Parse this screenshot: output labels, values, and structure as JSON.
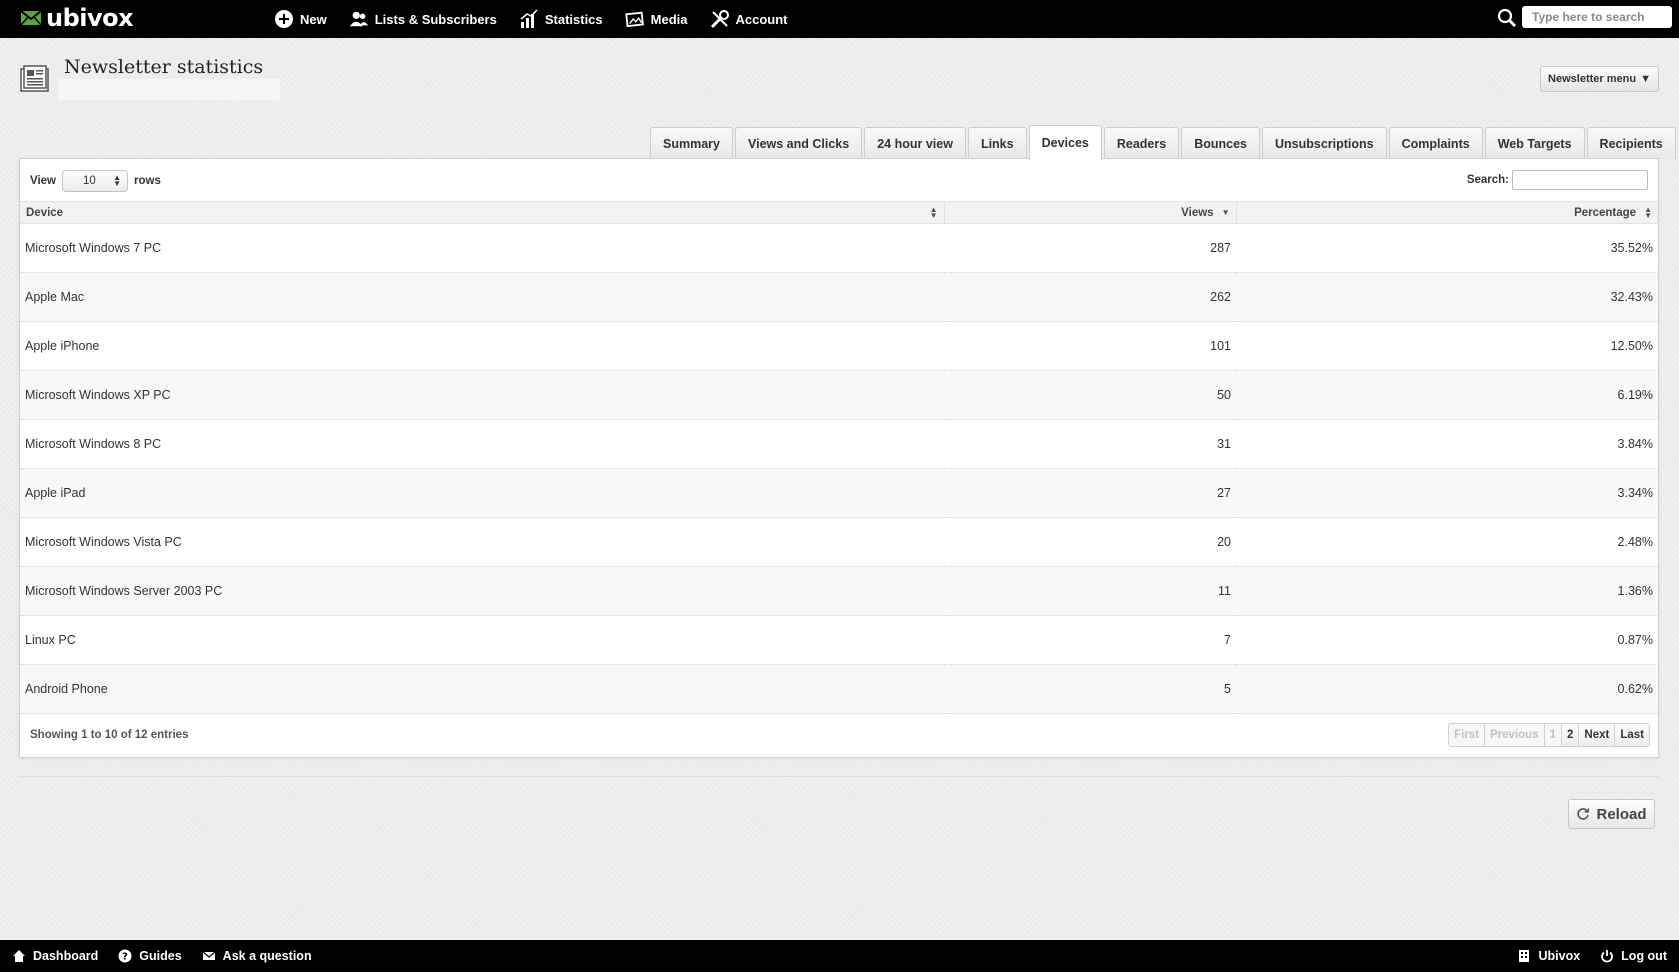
{
  "topbar": {
    "logo_text": "ubivox",
    "nav": [
      {
        "label": "New"
      },
      {
        "label": "Lists & Subscribers"
      },
      {
        "label": "Statistics"
      },
      {
        "label": "Media"
      },
      {
        "label": "Account"
      }
    ],
    "search_placeholder": "Type here to search"
  },
  "header": {
    "title": "Newsletter statistics",
    "menu_label": "Newsletter menu"
  },
  "tabs": [
    {
      "label": "Summary"
    },
    {
      "label": "Views and Clicks"
    },
    {
      "label": "24 hour view"
    },
    {
      "label": "Links"
    },
    {
      "label": "Devices",
      "active": true
    },
    {
      "label": "Readers"
    },
    {
      "label": "Bounces"
    },
    {
      "label": "Unsubscriptions"
    },
    {
      "label": "Complaints"
    },
    {
      "label": "Web Targets"
    },
    {
      "label": "Recipients"
    }
  ],
  "table": {
    "view_label": "View",
    "rows_value": "10",
    "rows_label": "rows",
    "search_label": "Search:",
    "columns": [
      "Device",
      "Views",
      "Percentage"
    ],
    "rows": [
      [
        "Microsoft Windows 7 PC",
        "287",
        "35.52%"
      ],
      [
        "Apple Mac",
        "262",
        "32.43%"
      ],
      [
        "Apple iPhone",
        "101",
        "12.50%"
      ],
      [
        "Microsoft Windows XP PC",
        "50",
        "6.19%"
      ],
      [
        "Microsoft Windows 8 PC",
        "31",
        "3.84%"
      ],
      [
        "Apple iPad",
        "27",
        "3.34%"
      ],
      [
        "Microsoft Windows Vista PC",
        "20",
        "2.48%"
      ],
      [
        "Microsoft Windows Server 2003 PC",
        "11",
        "1.36%"
      ],
      [
        "Linux PC",
        "7",
        "0.87%"
      ],
      [
        "Android Phone",
        "5",
        "0.62%"
      ]
    ],
    "info": "Showing 1 to 10 of 12 entries",
    "pager": {
      "first": "First",
      "previous": "Previous",
      "page1": "1",
      "page2": "2",
      "next": "Next",
      "last": "Last"
    }
  },
  "reload_label": "Reload",
  "footer": {
    "dashboard": "Dashboard",
    "guides": "Guides",
    "ask": "Ask a question",
    "ubivox": "Ubivox",
    "logout": "Log out"
  },
  "colors": {
    "bar": "#000000",
    "background": "#ededed",
    "panel": "#ffffff"
  }
}
